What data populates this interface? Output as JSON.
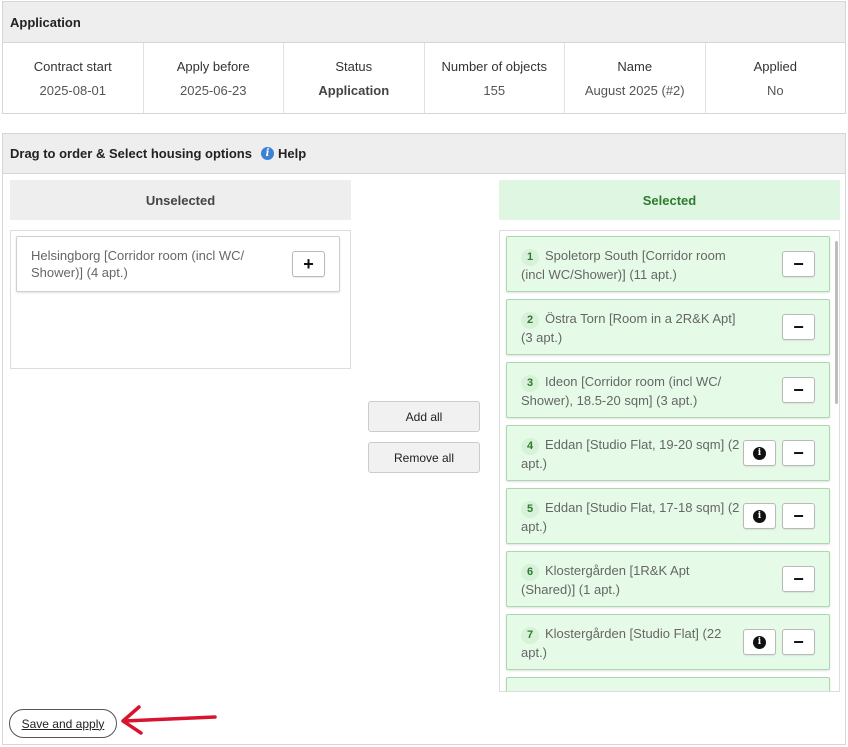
{
  "application": {
    "title": "Application",
    "fields": [
      {
        "label": "Contract start",
        "value": "2025-08-01"
      },
      {
        "label": "Apply before",
        "value": "2025-06-23"
      },
      {
        "label": "Status",
        "value": "Application"
      },
      {
        "label": "Number of objects",
        "value": "155"
      },
      {
        "label": "Name",
        "value": "August 2025 (#2)"
      },
      {
        "label": "Applied",
        "value": "No"
      }
    ]
  },
  "drag": {
    "title": "Drag to order & Select housing options",
    "help_label": "Help",
    "help_icon_glyph": "i",
    "unselected_heading": "Unselected",
    "selected_heading": "Selected",
    "add_all_label": "Add all",
    "remove_all_label": "Remove all",
    "plus_glyph": "+",
    "minus_glyph": "−",
    "info_glyph": "i",
    "unselected_items": [
      {
        "text": "Helsingborg [Corridor room (incl WC/ Shower)] (4 apt.)"
      }
    ],
    "selected_items": [
      {
        "num": "1",
        "text": "Spoletorp South [Corridor room (incl WC/Shower)] (11 apt.)",
        "has_info": false
      },
      {
        "num": "2",
        "text": "Östra Torn [Room in a 2R&K Apt] (3 apt.)",
        "has_info": false
      },
      {
        "num": "3",
        "text": "Ideon [Corridor room (incl WC/ Shower), 18.5-20 sqm] (3 apt.)",
        "has_info": false
      },
      {
        "num": "4",
        "text": "Eddan [Studio Flat, 19-20 sqm] (2 apt.)",
        "has_info": true
      },
      {
        "num": "5",
        "text": "Eddan [Studio Flat, 17-18 sqm] (2 apt.)",
        "has_info": true
      },
      {
        "num": "6",
        "text": "Klostergården [1R&K Apt (Shared)] (1 apt.)",
        "has_info": false
      },
      {
        "num": "7",
        "text": "Klostergården [Studio Flat] (22 apt.)",
        "has_info": true
      }
    ]
  },
  "save_label": "Save and apply",
  "colors": {
    "accent_green": "#2f7a2f",
    "selected_bg": "#e6fbe7",
    "arrow_red": "#d6162f",
    "help_blue": "#3b82d6"
  }
}
